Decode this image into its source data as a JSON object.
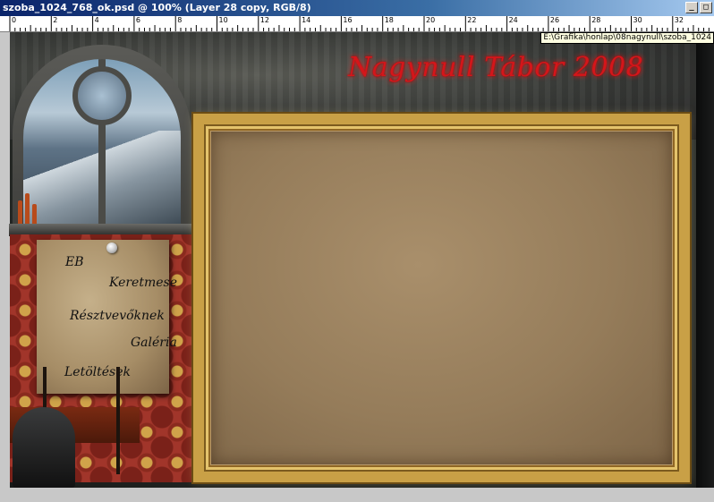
{
  "window": {
    "title": "szoba_1024_768_ok.psd @ 100% (Layer 28 copy, RGB/8)",
    "buttons": {
      "minimize": "_",
      "restore": "□"
    }
  },
  "ruler": {
    "labels": [
      "0",
      "2",
      "4",
      "6",
      "8",
      "10",
      "12",
      "14",
      "16",
      "18",
      "20",
      "22",
      "24",
      "26",
      "28",
      "30",
      "32"
    ]
  },
  "path_tooltip": "E:\\Grafika\\honlap\\08nagynull\\szoba_1024",
  "site": {
    "title": "Nagynull Tábor 2008"
  },
  "menu": {
    "items": [
      {
        "label": "EB"
      },
      {
        "label": "Keretmese"
      },
      {
        "label": "Résztvevőknek"
      },
      {
        "label": "Galéria"
      },
      {
        "label": "Letöltések"
      }
    ]
  },
  "colors": {
    "title_red": "#d4161a",
    "frame_gold": "#c9a046",
    "parchment": "#b99a6b",
    "wallpaper_red": "#a1352a"
  }
}
